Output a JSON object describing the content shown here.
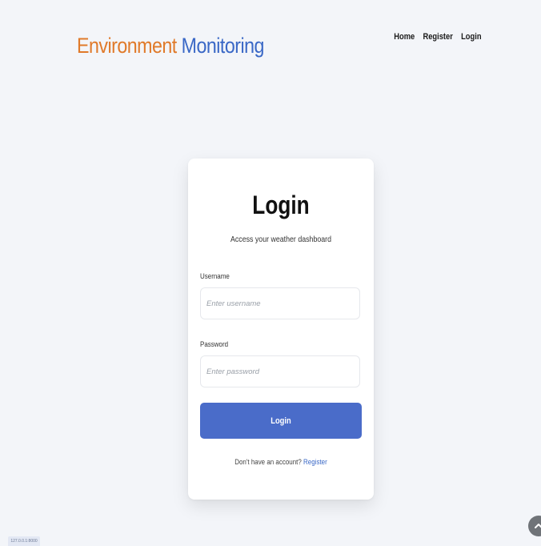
{
  "header": {
    "brand_part1": "Environment",
    "brand_part2": "Monitoring",
    "nav": [
      {
        "label": "Home"
      },
      {
        "label": "Register"
      },
      {
        "label": "Login"
      }
    ]
  },
  "login_card": {
    "title": "Login",
    "subtitle": "Access your weather dashboard",
    "username": {
      "label": "Username",
      "placeholder": "Enter username",
      "value": ""
    },
    "password": {
      "label": "Password",
      "placeholder": "Enter password",
      "value": ""
    },
    "submit_label": "Login",
    "register_prompt": "Don't have an account?",
    "register_link": "Register"
  },
  "footer": {
    "corner_tag": "127.0.0.1:8000"
  },
  "colors": {
    "brand_orange": "#e07a2a",
    "brand_blue": "#3a68c6",
    "button": "#4a6cc9",
    "background": "#f3f5f9"
  },
  "icons": {
    "scroll_top": "chevron-up-icon"
  }
}
